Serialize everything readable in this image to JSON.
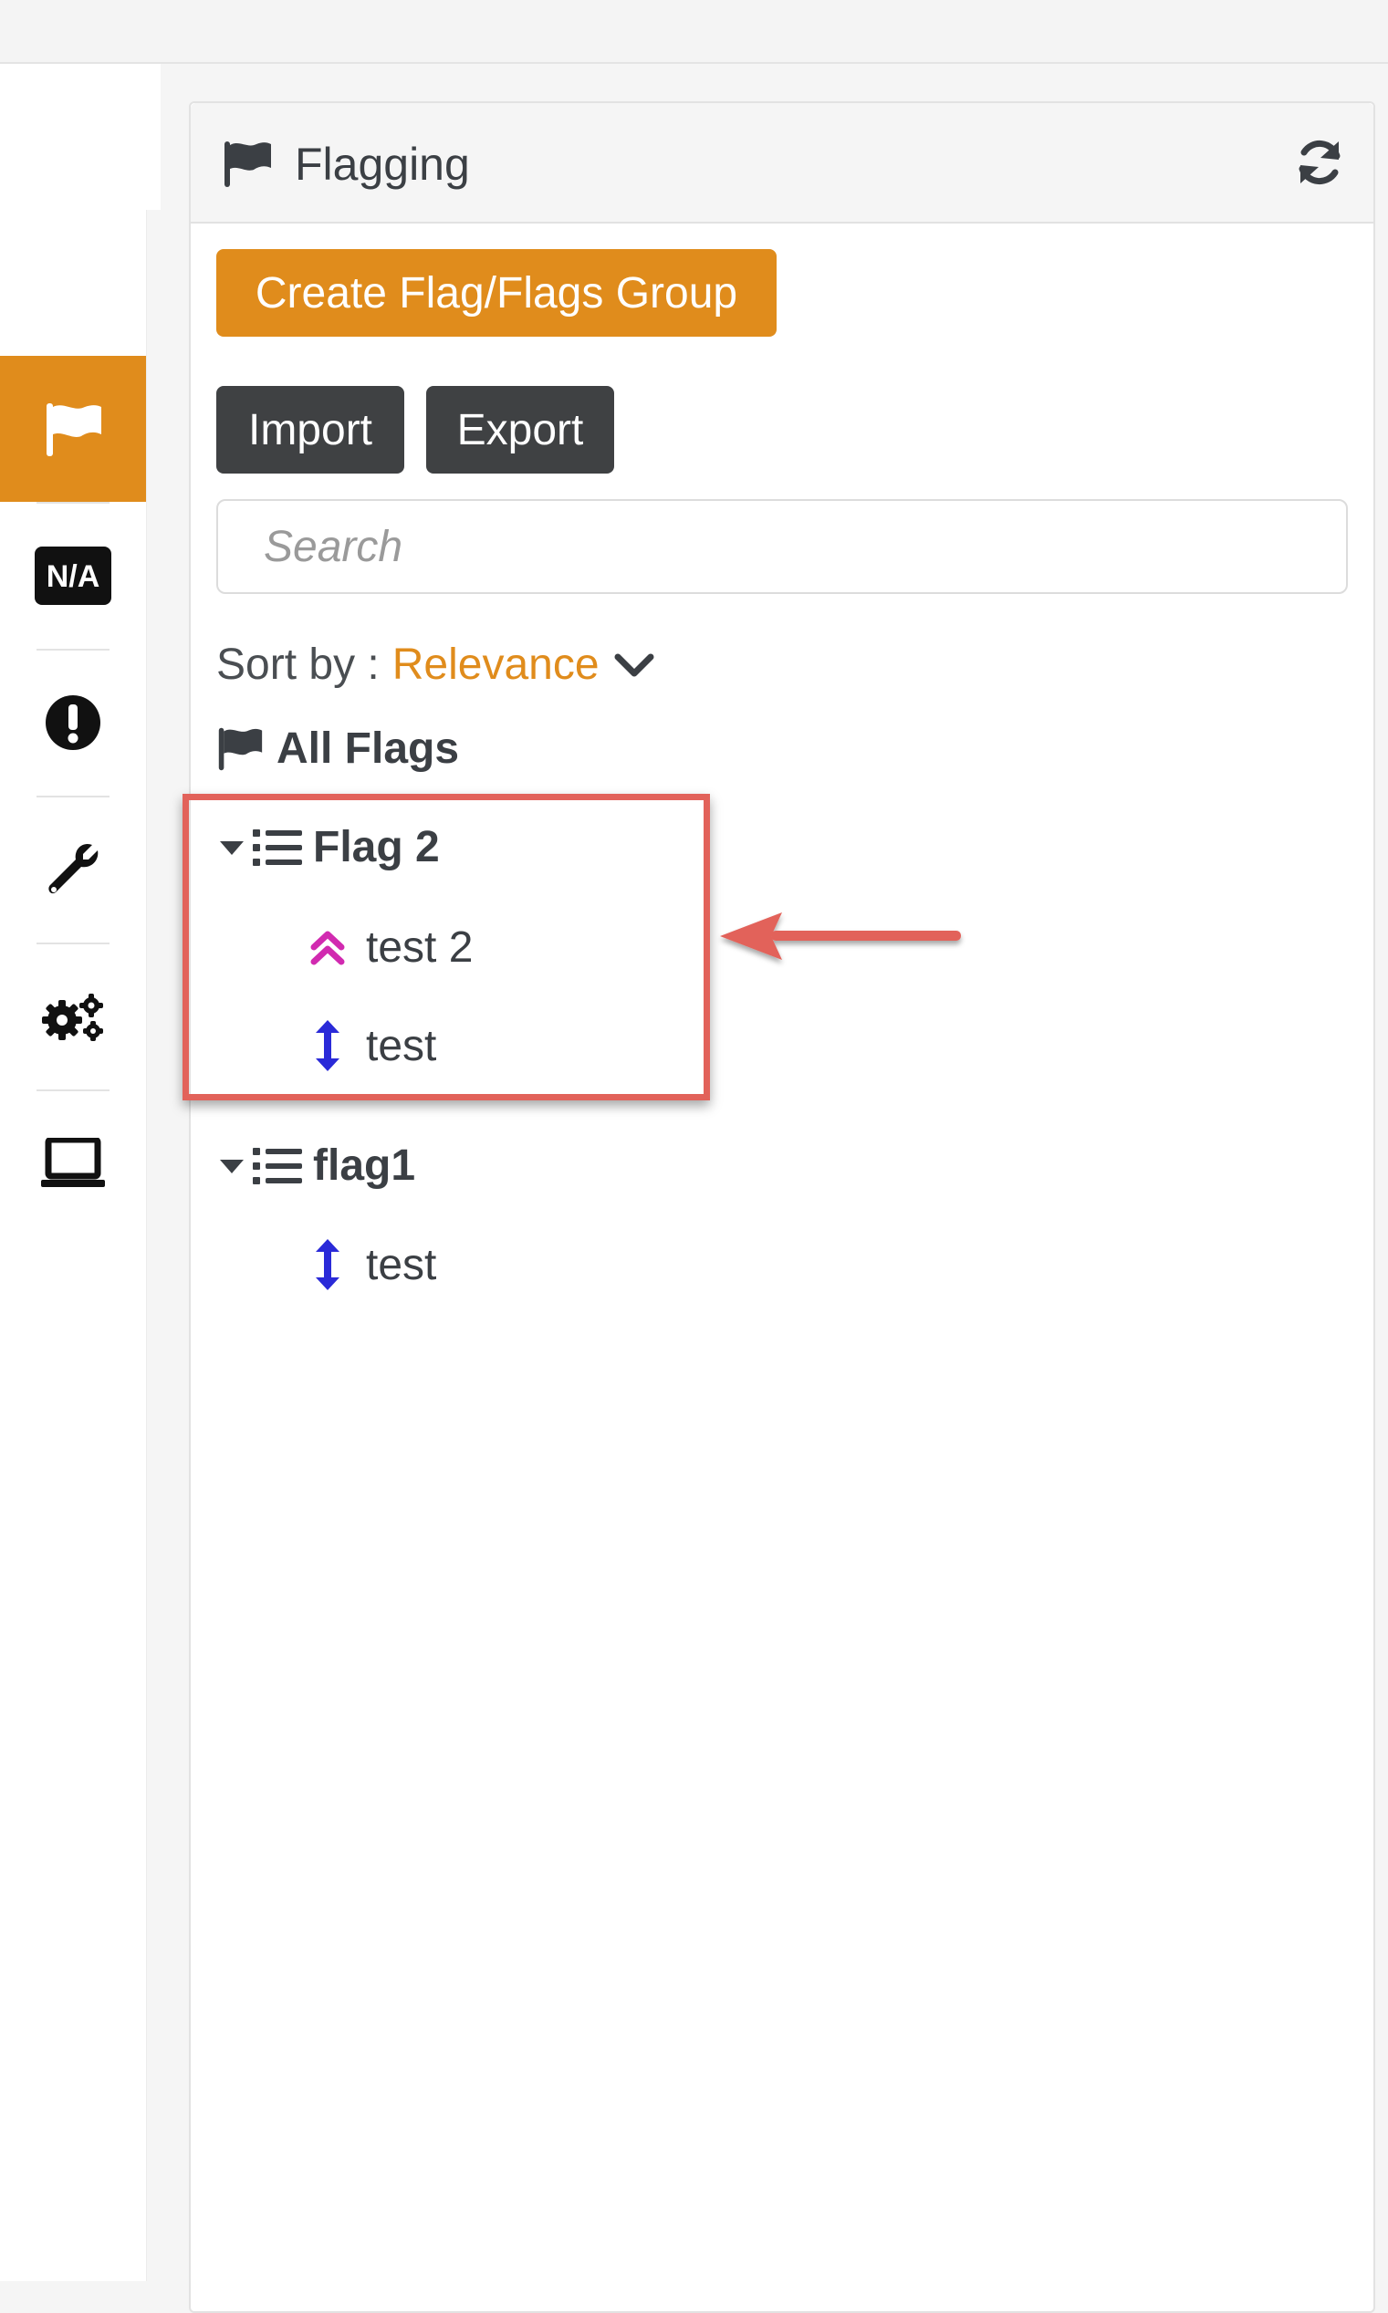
{
  "panel": {
    "title": "Flagging",
    "header_icon": "flag-icon",
    "refresh_icon": "refresh-icon"
  },
  "toolbar": {
    "create_label": "Create Flag/Flags Group",
    "import_label": "Import",
    "export_label": "Export"
  },
  "search": {
    "placeholder": "Search",
    "value": ""
  },
  "sort": {
    "label": "Sort by :",
    "value": "Relevance"
  },
  "all_flags": {
    "label": "All Flags"
  },
  "groups": [
    {
      "label": "Flag 2",
      "items": [
        {
          "label": "test 2",
          "icon": "double-chevron-up-icon",
          "icon_color": "#d12ab0"
        },
        {
          "label": "test",
          "icon": "vertical-arrows-icon",
          "icon_color": "#2a2ad8"
        }
      ]
    },
    {
      "label": "flag1",
      "items": [
        {
          "label": "test",
          "icon": "vertical-arrows-icon",
          "icon_color": "#2a2ad8"
        }
      ]
    }
  ],
  "sidebar": {
    "items": [
      {
        "name": "flag-icon",
        "active": true
      },
      {
        "name": "na-icon",
        "text": "N/A"
      },
      {
        "name": "exclamation-icon"
      },
      {
        "name": "wrench-icon"
      },
      {
        "name": "gears-icon"
      },
      {
        "name": "laptop-icon"
      }
    ]
  },
  "colors": {
    "accent": "#e08c1c",
    "dark_button": "#3f4143",
    "highlight": "#e2625a",
    "priority_high": "#d12ab0",
    "priority_normal": "#2a2ad8"
  }
}
